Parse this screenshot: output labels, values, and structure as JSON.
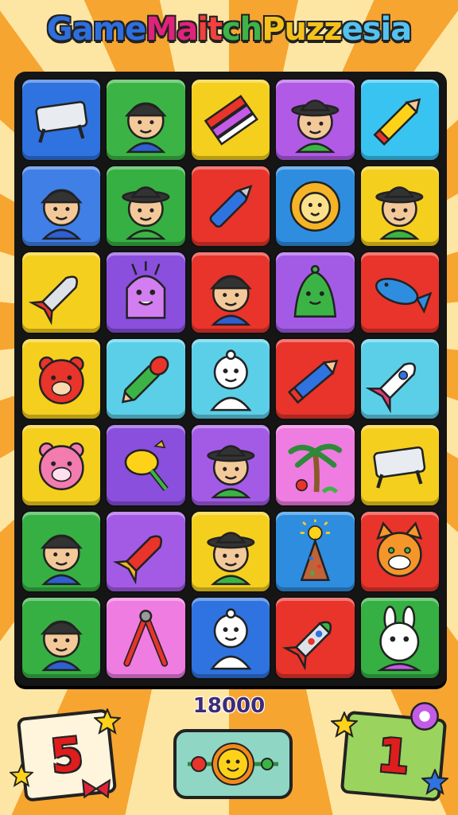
{
  "title": {
    "text_parts": [
      {
        "t": "Game ",
        "color": "#2e6fe0"
      },
      {
        "t": "Ma",
        "color": "#e0237a"
      },
      {
        "t": "it",
        "color": "#f04040"
      },
      {
        "t": "ch ",
        "color": "#3db34a"
      },
      {
        "t": "Puzz",
        "color": "#f5c21b"
      },
      {
        "t": "esia",
        "color": "#53c2f0"
      }
    ]
  },
  "board": {
    "tiles": [
      {
        "bg": "#2f73e0",
        "icon": "sign-board-icon"
      },
      {
        "bg": "#3cb445",
        "icon": "boy-cap-icon"
      },
      {
        "bg": "#f5cf1e",
        "icon": "crayons-icon"
      },
      {
        "bg": "#b15ae6",
        "icon": "boy-hat-icon"
      },
      {
        "bg": "#39c3f0",
        "icon": "pencil-icon"
      },
      {
        "bg": "#3f7fe6",
        "icon": "boy-cap-icon"
      },
      {
        "bg": "#36b043",
        "icon": "boy-hat-icon"
      },
      {
        "bg": "#e8342b",
        "icon": "blue-pen-icon"
      },
      {
        "bg": "#2f8de0",
        "icon": "lion-icon"
      },
      {
        "bg": "#f5cf1e",
        "icon": "boy-hat-icon"
      },
      {
        "bg": "#f5cf1e",
        "icon": "rocket-icon"
      },
      {
        "bg": "#8a4fdd",
        "icon": "purple-monster-icon"
      },
      {
        "bg": "#e8342b",
        "icon": "boy-cap-icon"
      },
      {
        "bg": "#a35be6",
        "icon": "green-ghost-icon"
      },
      {
        "bg": "#e8342b",
        "icon": "fish-icon"
      },
      {
        "bg": "#f5cf1e",
        "icon": "red-bear-icon"
      },
      {
        "bg": "#5ccfe8",
        "icon": "green-pen-icon"
      },
      {
        "bg": "#5ccfe8",
        "icon": "snowman-icon"
      },
      {
        "bg": "#e8342b",
        "icon": "blue-crayon-icon"
      },
      {
        "bg": "#5ccfe8",
        "icon": "rocket-pink-icon"
      },
      {
        "bg": "#f5cf1e",
        "icon": "pink-bear-icon"
      },
      {
        "bg": "#8a4fdd",
        "icon": "yellow-top-icon"
      },
      {
        "bg": "#a35be6",
        "icon": "boy-hat-icon"
      },
      {
        "bg": "#ef7ce0",
        "icon": "palm-tree-icon"
      },
      {
        "bg": "#f5cf1e",
        "icon": "sign-board-icon"
      },
      {
        "bg": "#36b043",
        "icon": "boy-cap-icon"
      },
      {
        "bg": "#a35be6",
        "icon": "red-rocket-icon"
      },
      {
        "bg": "#f5cf1e",
        "icon": "boy-hat-icon"
      },
      {
        "bg": "#2f8de0",
        "icon": "sun-tree-icon"
      },
      {
        "bg": "#e8342b",
        "icon": "cat-icon"
      },
      {
        "bg": "#36b043",
        "icon": "boy-cap-icon"
      },
      {
        "bg": "#ef7ce0",
        "icon": "compass-tool-icon"
      },
      {
        "bg": "#2f73e0",
        "icon": "snowman-icon"
      },
      {
        "bg": "#e8342b",
        "icon": "green-rocket-icon"
      },
      {
        "bg": "#36b043",
        "icon": "bunny-icon"
      }
    ]
  },
  "score": "18000",
  "moves_card": {
    "value": "5"
  },
  "level_card": {
    "value": "1"
  },
  "booster": {
    "icon": "sun-flower-booster-icon"
  }
}
